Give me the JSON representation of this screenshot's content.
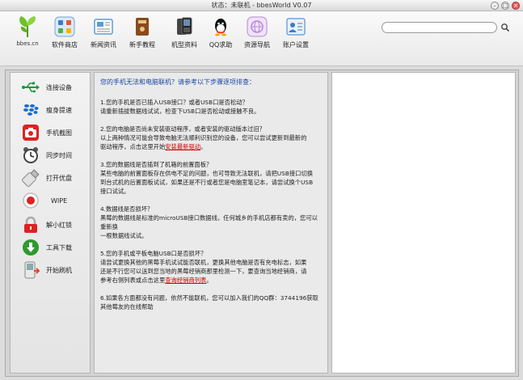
{
  "window": {
    "title": "状态：未联机 - bbesWorld V0.07",
    "minimize_glyph": "–",
    "maximize_glyph": "□",
    "close_glyph": "×"
  },
  "logo": {
    "label": "bbes.cn"
  },
  "toolbar": {
    "items": [
      {
        "label": "软件商店",
        "icon": "apps-icon",
        "color": "#3a7bd5"
      },
      {
        "label": "新闻资讯",
        "icon": "news-icon",
        "color": "#5b9bd5"
      },
      {
        "label": "新手教程",
        "icon": "book-icon",
        "color": "#8a4a1c"
      },
      {
        "label": "机型资料",
        "icon": "phone-icon",
        "color": "#333333"
      },
      {
        "label": "QQ求助",
        "icon": "qq-icon",
        "color": "#111111"
      },
      {
        "label": "资源导航",
        "icon": "globe-icon",
        "color": "#b88ad8"
      },
      {
        "label": "账户设置",
        "icon": "account-icon",
        "color": "#3d7cc9"
      }
    ]
  },
  "search": {
    "value": "",
    "placeholder": ""
  },
  "sidebar": {
    "items": [
      {
        "label": "连接设备",
        "icon": "usb-icon"
      },
      {
        "label": "瘦身提速",
        "icon": "blackberry-icon"
      },
      {
        "label": "手机截图",
        "icon": "camera-icon"
      },
      {
        "label": "同步时间",
        "icon": "clock-icon"
      },
      {
        "label": "打开优盘",
        "icon": "usb-drive-icon"
      },
      {
        "label": "WIPE",
        "icon": "wipe-icon"
      },
      {
        "label": "解小红锁",
        "icon": "lock-icon"
      },
      {
        "label": "工具下载",
        "icon": "download-icon"
      },
      {
        "label": "开始刷机",
        "icon": "flash-icon"
      }
    ]
  },
  "content": {
    "heading": "您的手机无法和电脑联机？请参考以下步骤逐项排查：",
    "s1_l1": "1.您的手机是否已插入USB接口？或者USB口是否松动？",
    "s1_l2": "请重新插拔数据线试试，检查下USB口是否松动或接触不良。",
    "s2_l1": "2.您的电脑是否尚未安装驱动程序，或者安装的驱动版本过旧？",
    "s2_l2": "以上两种情况可能会导致电脑无法顺利识别您的设备，您可以尝试更新到最新的",
    "s2_l3": "驱动程序，点击这里开始",
    "s2_link": "安装最新驱动",
    "s2_end": "。",
    "s3_l1": "3.您的数据线是否插到了机箱的前置面板？",
    "s3_l2": "某些电脑的前置面板存在供电不足的问题，也可导致无法联机，请把USB接口切换",
    "s3_l3": "到台式机的后置面板试试，如果还是不行或者您是电脑室笔记本，请尝试换个USB",
    "s3_l4": "接口试试。",
    "s4_l1": "4.数据线是否损坏？",
    "s4_l2": "黑莓的数据线是标准的microUSB接口数据线，任何城乡的手机店都有卖的，您可以重新换",
    "s4_l3": "一根数据线试试。",
    "s5_l1": "5.您的手机或平板电脑USB口是否损坏？",
    "s5_l2": "请尝试更换其他的黑莓手机试试能否联机，更换其他电脑是否有充电标志，如果",
    "s5_l3": "还是不行您可以送到您当地的黑莓经销商那里检测一下，要查询当地经销商，请",
    "s5_l4": "参考右侧列表或点击这里",
    "s5_link": "查询经销商列表",
    "s5_end": "。",
    "s6_l1": "6.如果各方面都没有问题，依然不能联机，您可以加入我们的QQ群：37441​96获取",
    "s6_l2": "其他莓友的在线帮助"
  }
}
